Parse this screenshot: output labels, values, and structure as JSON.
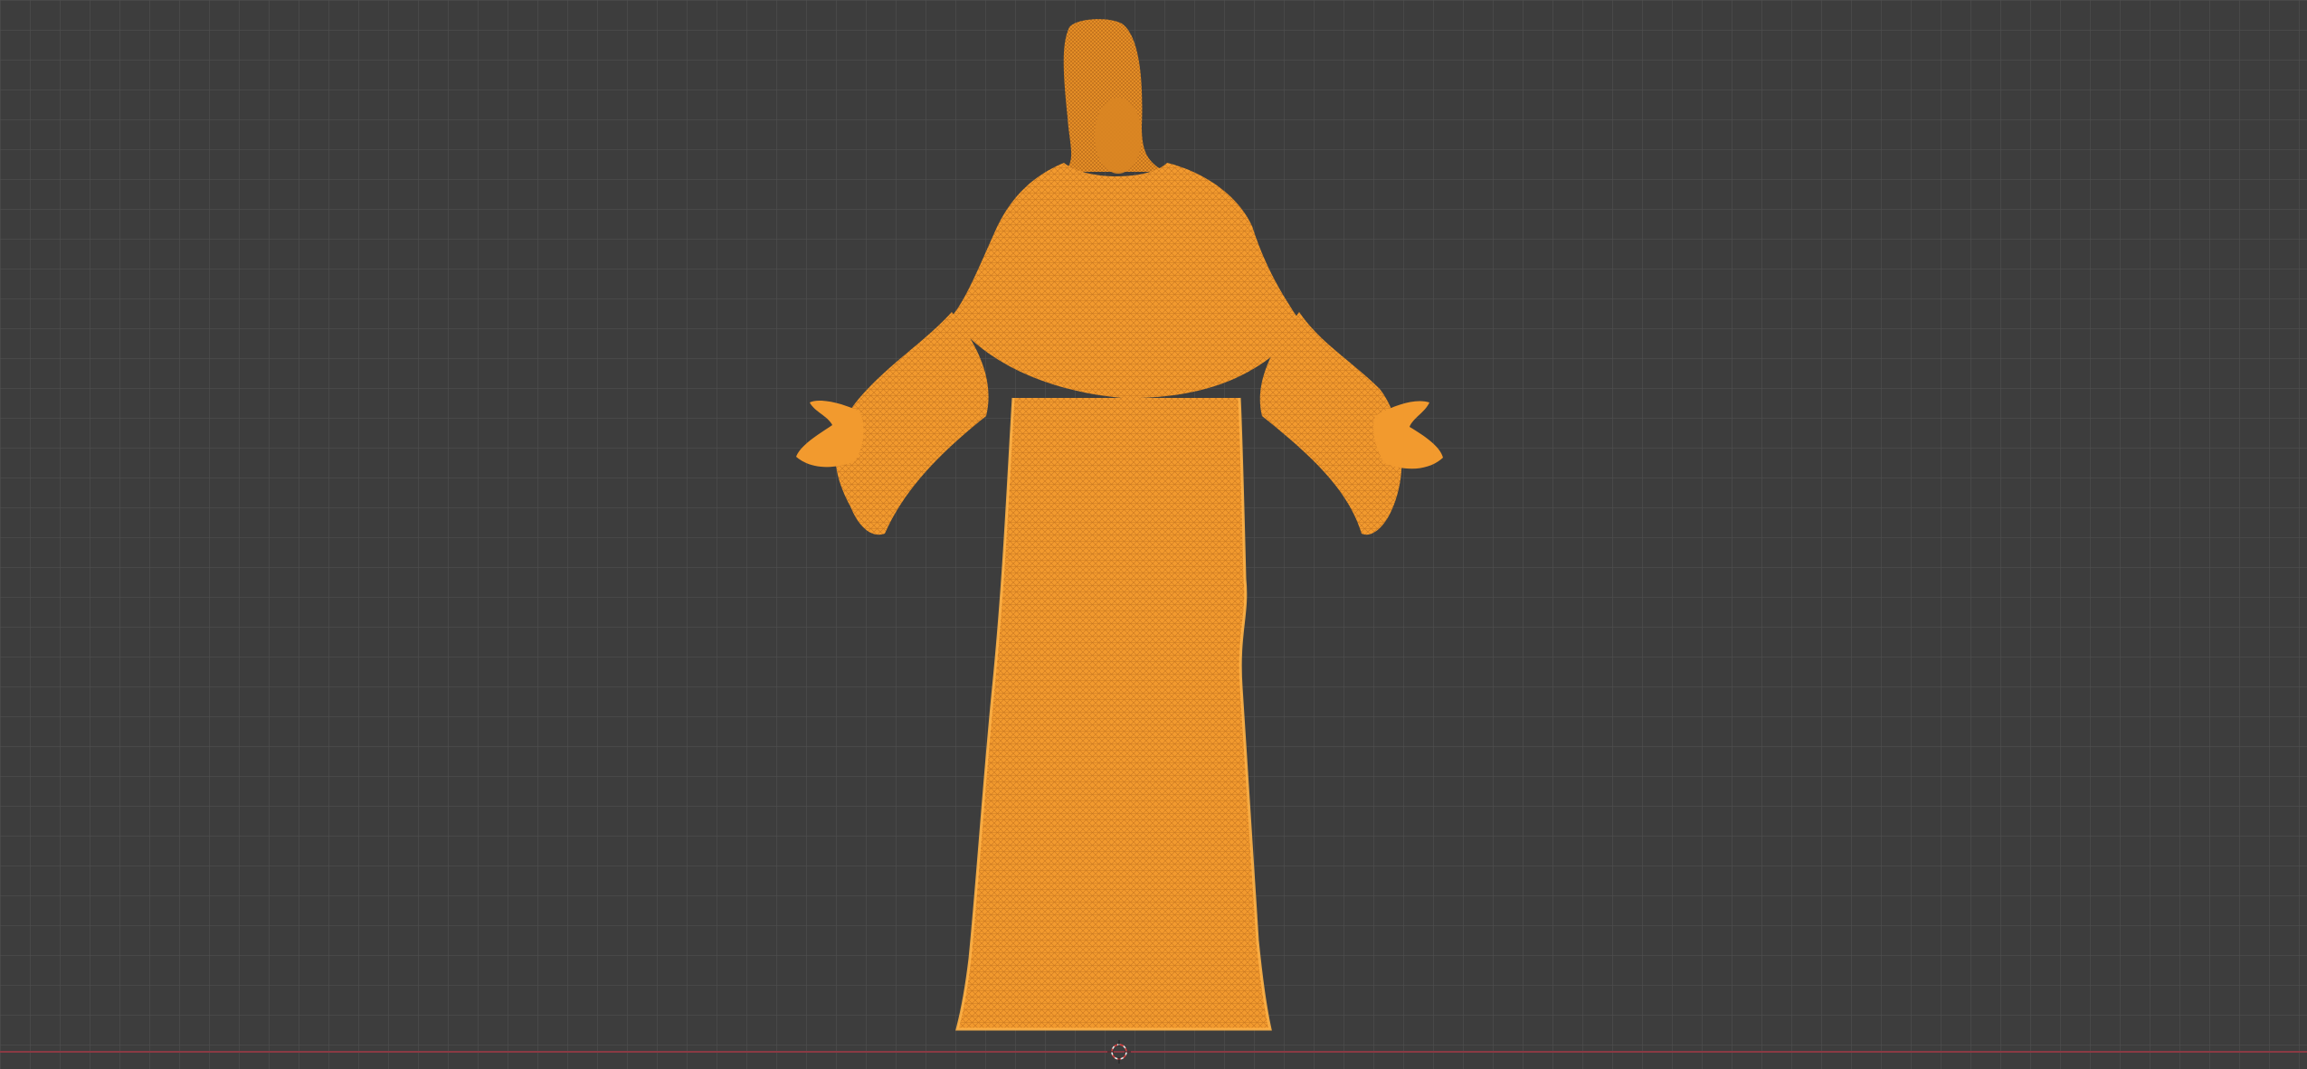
{
  "viewport": {
    "background_color": "#3d3d3d",
    "grid_color": "#505050",
    "x_axis_color": "#8a3a44"
  },
  "object": {
    "icon": "statue-wireframe-mesh",
    "selection_color": "#f5a033",
    "wire_color": "#b86a14",
    "selected": true
  },
  "cursor_3d": {
    "icon": "3d-cursor-icon"
  }
}
